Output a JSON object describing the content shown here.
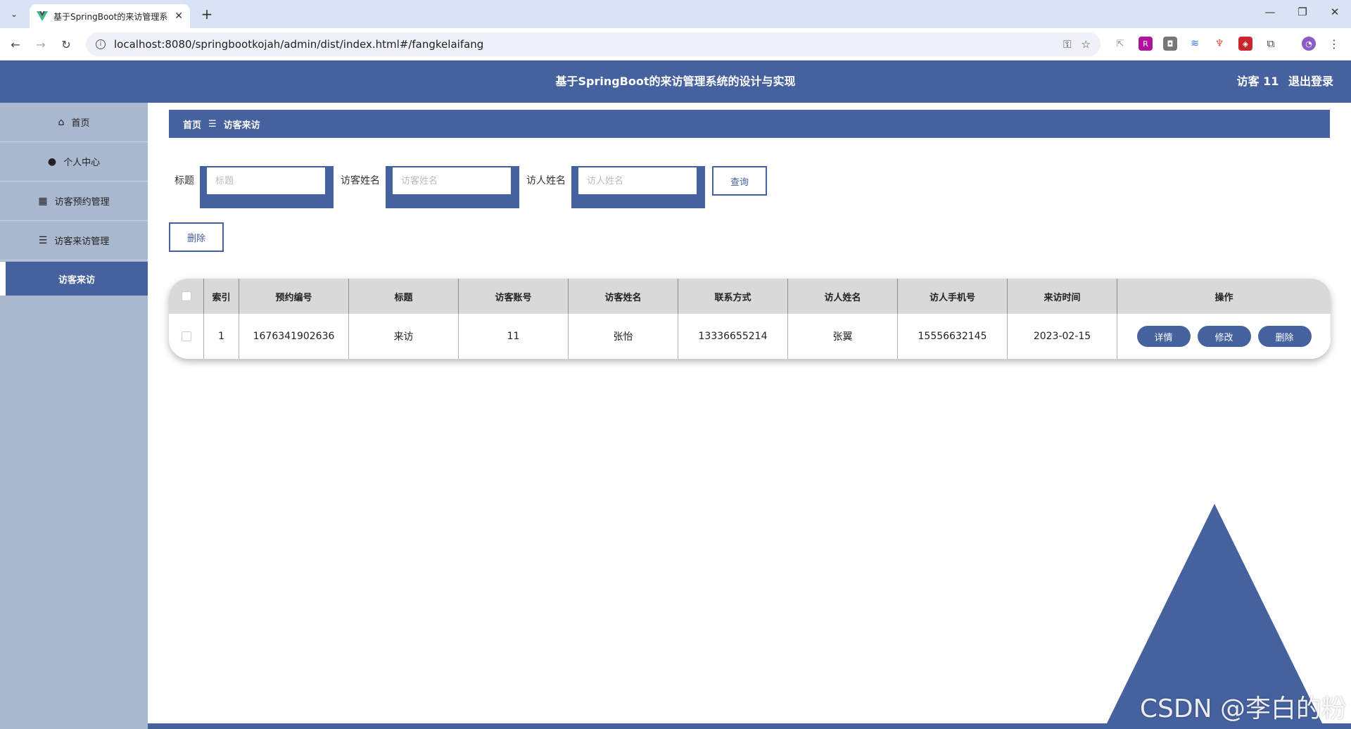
{
  "browser": {
    "tab_title": "基于SpringBoot的来访管理系",
    "url": "localhost:8080/springbootkojah/admin/dist/index.html#/fangkelaifang"
  },
  "header": {
    "title": "基于SpringBoot的来访管理系统的设计与实现",
    "user": "访客 11",
    "logout": "退出登录"
  },
  "sidebar": {
    "items": [
      {
        "label": "首页",
        "icon": "home-icon"
      },
      {
        "label": "个人中心",
        "icon": "user-icon"
      },
      {
        "label": "访客预约管理",
        "icon": "grid-icon"
      },
      {
        "label": "访客来访管理",
        "icon": "list-icon"
      }
    ],
    "active_sub": "访客来访"
  },
  "breadcrumb": {
    "home": "首页",
    "separator": "☰",
    "current": "访客来访"
  },
  "search": {
    "title_label": "标题",
    "title_placeholder": "标题",
    "visitor_label": "访客姓名",
    "visitor_placeholder": "访客姓名",
    "host_label": "访人姓名",
    "host_placeholder": "访人姓名",
    "query_button": "查询"
  },
  "actions": {
    "delete_button": "删除"
  },
  "table": {
    "columns": [
      "索引",
      "预约编号",
      "标题",
      "访客账号",
      "访客姓名",
      "联系方式",
      "访人姓名",
      "访人手机号",
      "来访时间",
      "操作"
    ],
    "rows": [
      {
        "index": "1",
        "booking_no": "1676341902636",
        "title": "来访",
        "account": "11",
        "visitor_name": "张怡",
        "phone": "13336655214",
        "host_name": "张翼",
        "host_phone": "15556632145",
        "visit_time": "2023-02-15",
        "ops": [
          "详情",
          "修改",
          "删除"
        ]
      }
    ]
  },
  "watermark": "CSDN @李白的粉",
  "colors": {
    "primary": "#45619e",
    "sidebar": "#a9b7cf",
    "table_header": "#d9d9d9"
  }
}
